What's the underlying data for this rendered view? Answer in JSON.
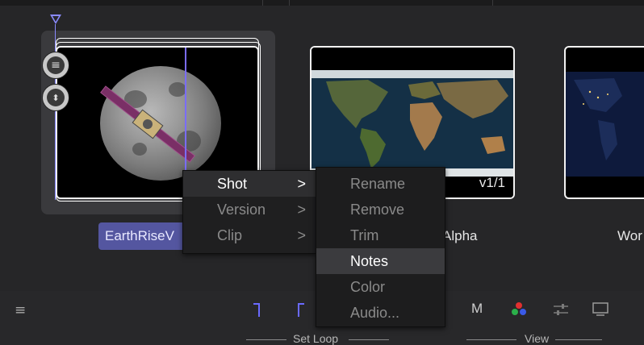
{
  "clips": [
    {
      "name": "EarthRiseV",
      "version": ""
    },
    {
      "name": "Alpha",
      "version": "v1/1"
    },
    {
      "name": "Wor",
      "version": ""
    }
  ],
  "context_menu": {
    "items": [
      {
        "label": "Shot",
        "arrow": ">"
      },
      {
        "label": "Version",
        "arrow": ">"
      },
      {
        "label": "Clip",
        "arrow": ">"
      }
    ]
  },
  "submenu": {
    "items": [
      {
        "label": "Rename"
      },
      {
        "label": "Remove"
      },
      {
        "label": "Trim"
      },
      {
        "label": "Notes"
      },
      {
        "label": "Color"
      },
      {
        "label": "Audio..."
      }
    ]
  },
  "toolbar": {
    "menu_icon": "≡",
    "m_label": "M",
    "set_loop_label": "Set Loop",
    "view_label": "View"
  },
  "colors": {
    "selection_accent": "#5456a0",
    "playhead": "#7a6cff"
  }
}
